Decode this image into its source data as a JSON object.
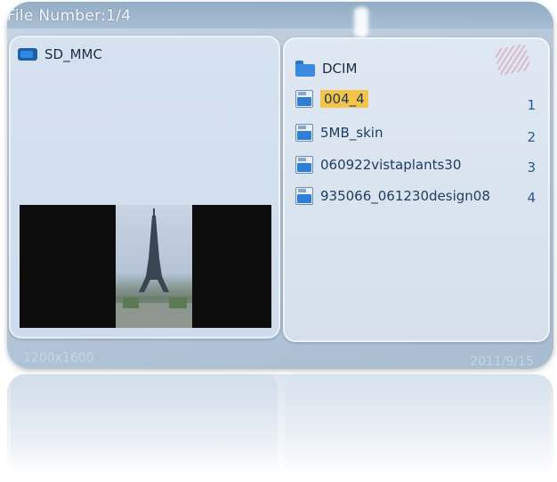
{
  "header": {
    "file_number": "File Number:1/4"
  },
  "device": {
    "label": "SD_MMC",
    "icon": "sd-card-icon"
  },
  "preview": {
    "resolution": "1200x1600",
    "date": "2011/9/15"
  },
  "file_list": {
    "folder": {
      "label": "DCIM",
      "icon": "folder-icon"
    },
    "items": [
      {
        "label": "004_4",
        "index": "1",
        "selected": true,
        "icon": "image-file-icon"
      },
      {
        "label": "5MB_skin",
        "index": "2",
        "selected": false,
        "icon": "image-file-icon"
      },
      {
        "label": "060922vistaplants30",
        "index": "3",
        "selected": false,
        "icon": "image-file-icon"
      },
      {
        "label": "935066_061230design08",
        "index": "4",
        "selected": false,
        "icon": "image-file-icon"
      }
    ]
  },
  "colors": {
    "selection": "#f3c44a",
    "panel": "#d6e2ef",
    "accent": "#2f7fd8"
  }
}
